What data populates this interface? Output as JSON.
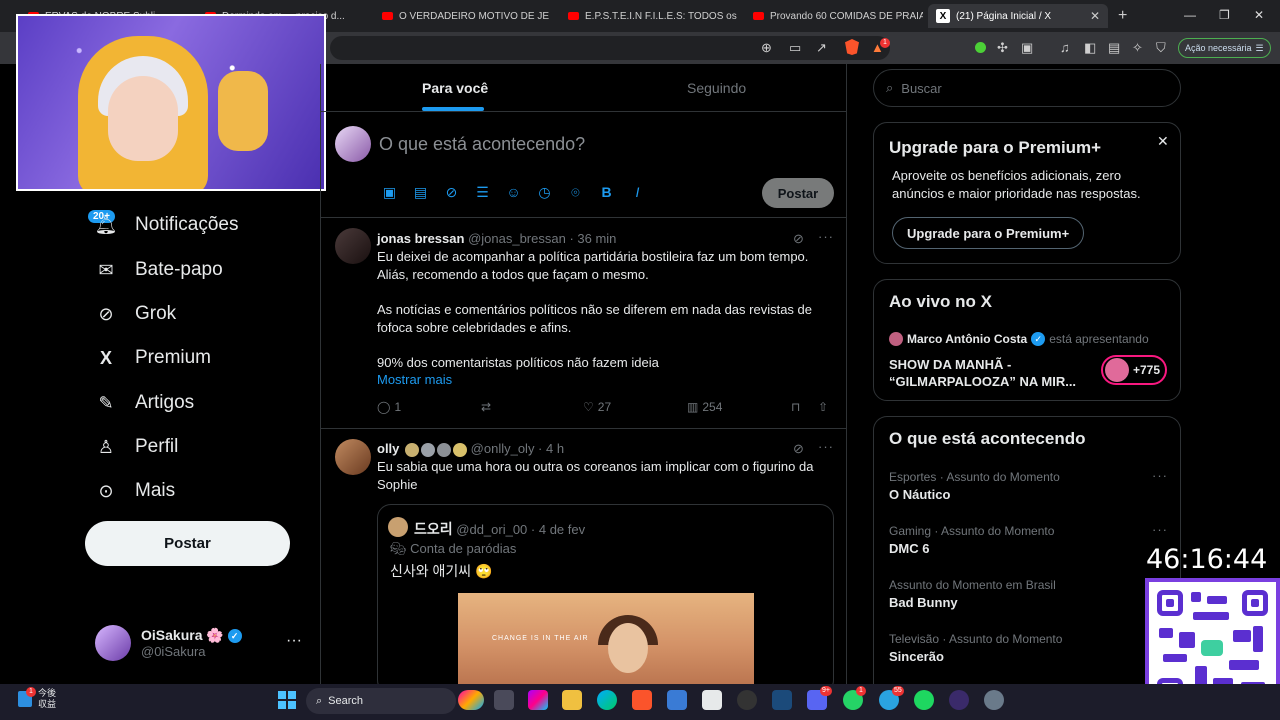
{
  "browser": {
    "tabs": [
      {
        "label": "ERVAS de NOBRE Subli..."
      },
      {
        "label": "Dormindo em ... preciso d..."
      },
      {
        "label": "O VERDADEIRO MOTIVO DE JET L..."
      },
      {
        "label": "E.P.S.T.E.I.N F.I.L.E.S: TODOS os SEG..."
      },
      {
        "label": "Provando 60 COMIDAS DE PRAIA..."
      },
      {
        "label": "(21) Página Inicial / X"
      }
    ],
    "new_tab": "+",
    "brave_badge": "1",
    "status_pill": "Ação necessária"
  },
  "sidebar": {
    "notif_badge": "20+",
    "items": [
      {
        "label": "Notificações",
        "icon": "bell-icon"
      },
      {
        "label": "Bate-papo",
        "icon": "mail-icon"
      },
      {
        "label": "Grok",
        "icon": "grok-icon"
      },
      {
        "label": "Premium",
        "icon": "x-logo-icon"
      },
      {
        "label": "Artigos",
        "icon": "articles-icon"
      },
      {
        "label": "Perfil",
        "icon": "person-icon"
      },
      {
        "label": "Mais",
        "icon": "more-circle-icon"
      }
    ],
    "post_button": "Postar",
    "account": {
      "name": "OiSakura",
      "emoji": "🌸",
      "handle": "@0iSakura",
      "more": "···"
    }
  },
  "feed": {
    "tabs": [
      "Para você",
      "Seguindo"
    ],
    "composer": {
      "placeholder": "O que está acontecendo?",
      "post_button": "Postar"
    },
    "posts": [
      {
        "name": "jonas bressan",
        "handle": "@jonas_bressan",
        "time": "36 min",
        "lines": [
          "Eu deixei de acompanhar a política partidária bostileira faz um bom tempo.",
          "Aliás, recomendo a todos que façam o mesmo.",
          "As notícias e comentários políticos não se diferem em nada das revistas de",
          "fofoca sobre celebridades e afins.",
          "90% dos comentaristas políticos não fazem ideia"
        ],
        "show_more": "Mostrar mais",
        "replies": "1",
        "likes": "27",
        "views": "254"
      },
      {
        "name": "olly",
        "handle": "@onlly_oly",
        "time": "4 h",
        "lines": [
          "Eu sabia que uma hora ou outra os coreanos iam implicar com o figurino da",
          "Sophie"
        ],
        "quote": {
          "name": "드오리",
          "handle": "@dd_ori_00",
          "time": "4 de fev",
          "parody": "Conta de paródias",
          "text": "신사와 애기씨 🙄",
          "image_caption": "CHANGE IS IN THE AIR"
        }
      }
    ]
  },
  "right": {
    "search_placeholder": "Buscar",
    "premium": {
      "title": "Upgrade para o Premium+",
      "text": "Aproveite os benefícios adicionais, zero anúncios e maior prioridade nas respostas.",
      "button": "Upgrade para o Premium+"
    },
    "live": {
      "title": "Ao vivo no X",
      "host": "Marco Antônio Costa",
      "status": "está apresentando",
      "show": "SHOW DA MANHÃ - “GILMARPALOOZA” NA MIR...",
      "count": "+775"
    },
    "trends": {
      "title": "O que está acontecendo",
      "items": [
        {
          "meta": "Esportes · Assunto do Momento",
          "name": "O Náutico"
        },
        {
          "meta": "Gaming · Assunto do Momento",
          "name": "DMC 6"
        },
        {
          "meta": "Assunto do Momento em Brasil",
          "name": "Bad Bunny"
        },
        {
          "meta": "Televisão · Assunto do Momento",
          "name": "Sincerão"
        }
      ]
    }
  },
  "overlay": {
    "timer": "46:16:44"
  },
  "taskbar": {
    "weather_line1": "今後",
    "weather_line2": "収益",
    "search": "Search",
    "badges": [
      "1",
      "9+",
      "1",
      "55"
    ]
  },
  "colors": {
    "accent": "#1d9bf0",
    "background": "#000000",
    "live": "#f91880",
    "verified": "#1d9bf0"
  }
}
